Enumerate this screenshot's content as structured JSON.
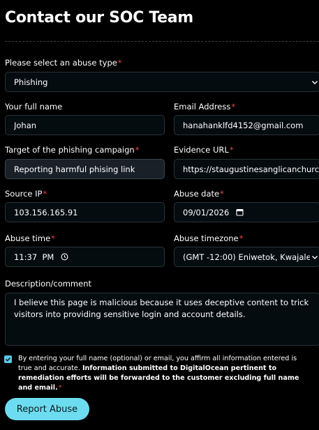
{
  "page_title": "Contact our SOC Team",
  "required_mark": "*",
  "abuse_type": {
    "label": "Please select an abuse type",
    "value": "Phishing"
  },
  "full_name": {
    "label": "Your full name",
    "value": "Johan"
  },
  "email": {
    "label": "Email Address",
    "value": "hanahanklfd4152@gmail.com"
  },
  "target": {
    "label": "Target of the phishing campaign",
    "value": "Reporting harmful phising link"
  },
  "evidence_url": {
    "label": "Evidence URL",
    "value": "https://staugustinesanglicanchurch.co"
  },
  "source_ip": {
    "label": "Source IP",
    "value": "103.156.165.91"
  },
  "abuse_date": {
    "label": "Abuse date",
    "value": "09/01/2026"
  },
  "abuse_time": {
    "label": "Abuse time",
    "value": "11:37  PM"
  },
  "abuse_timezone": {
    "label": "Abuse timezone",
    "value": "(GMT -12:00) Eniwetok, Kwajale"
  },
  "description": {
    "label": "Description/comment",
    "value": "I believe this page is malicious because it uses deceptive content to trick visitors into providing sensitive login and account details."
  },
  "consent": {
    "checked": true,
    "text_regular": "By entering your full name (optional) or email, you affirm all information entered is true and accurate. ",
    "text_bold": "Information submitted to DigitalOcean pertinent to remediation efforts will be forwarded to the customer excluding full name and email."
  },
  "submit_label": "Report Abuse",
  "colors": {
    "accent": "#6edcf0",
    "required": "#e5484d",
    "background": "#000000"
  }
}
